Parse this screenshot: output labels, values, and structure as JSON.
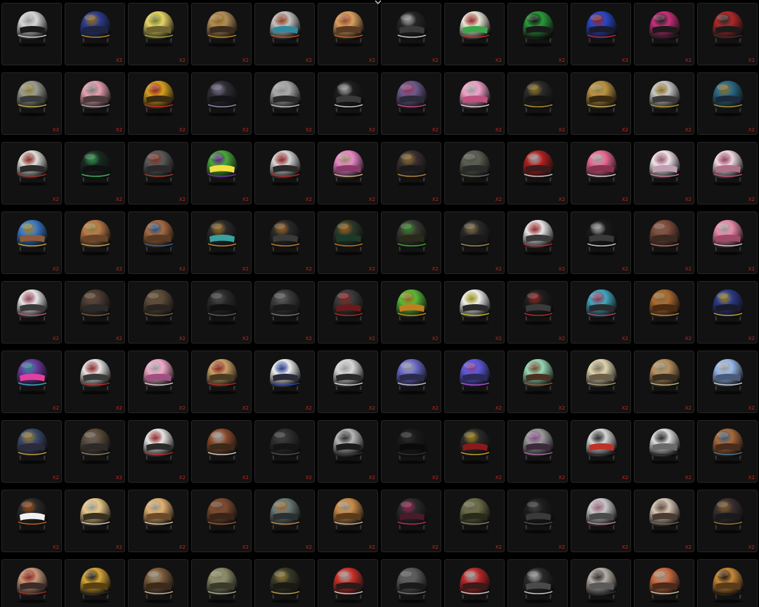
{
  "quantity_color": "#c2281d",
  "items": [
    {
      "icon": "white-viking-helmet-icon",
      "qty": "",
      "main": "#d6d6d6",
      "accent": "#f2f2f2",
      "visor": "#1a1a1a"
    },
    {
      "icon": "blue-stronghold-helmet-icon",
      "qty": "X2",
      "main": "#2b3c8f",
      "accent": "#e0a020",
      "visor": "#1d2440"
    },
    {
      "icon": "yellow-lemon-helmet-icon",
      "qty": "X2",
      "main": "#e7d466",
      "accent": "#b8c24a",
      "visor": "#6d6432"
    },
    {
      "icon": "tan-camo-helmet-icon",
      "qty": "X2",
      "main": "#b08c5a",
      "accent": "#e0a030",
      "visor": "#3a2c1c"
    },
    {
      "icon": "racing-orange-visor-helmet-icon",
      "qty": "X2",
      "main": "#c4c4c4",
      "accent": "#d85a28",
      "visor": "#2f8aa0"
    },
    {
      "icon": "chick-helmet-icon",
      "qty": "X2",
      "main": "#d8a060",
      "accent": "#e0703a",
      "visor": "#5a3a22"
    },
    {
      "icon": "black-white-striped-helmet-icon",
      "qty": "X2",
      "main": "#262626",
      "accent": "#f0f0f0",
      "visor": "#3a3a3a"
    },
    {
      "icon": "rooster-helmet-icon",
      "qty": "X2",
      "main": "#e8e8d8",
      "accent": "#e03028",
      "visor": "#3aa84a"
    },
    {
      "icon": "green-motocross-helmet-icon",
      "qty": "X2",
      "main": "#2a9a3a",
      "accent": "#121212",
      "visor": "#1a1a1a"
    },
    {
      "icon": "blue-motocross-helmet-icon",
      "qty": "X3",
      "main": "#2848c8",
      "accent": "#e03030",
      "visor": "#1a1a2a"
    },
    {
      "icon": "pink-motocross-helmet-icon",
      "qty": "X2",
      "main": "#c8307a",
      "accent": "#2a2a2a",
      "visor": "#1a1a1a"
    },
    {
      "icon": "red-motocross-helmet-icon",
      "qty": "X2",
      "main": "#b02828",
      "accent": "#3a3a3a",
      "visor": "#1a1a1a"
    },
    {
      "icon": "gray-star-helmet-icon",
      "qty": "X3",
      "main": "#9a9a92",
      "accent": "#d8c858",
      "visor": "#3a3a3a"
    },
    {
      "icon": "pink-bear-helmet-icon",
      "qty": "X2",
      "main": "#e8a0b0",
      "accent": "#c0c0c0",
      "visor": "#4a3a3a"
    },
    {
      "icon": "gold-chicken-helmet-icon",
      "qty": "X2",
      "main": "#d4a020",
      "accent": "#e03030",
      "visor": "#3a2a10"
    },
    {
      "icon": "black-level3-helmet-icon",
      "qty": "X2",
      "main": "#2e2e34",
      "accent": "#b0a0c8",
      "visor": "#141418"
    },
    {
      "icon": "silver-level3-helmet-icon",
      "qty": "X2",
      "main": "#a8a8a8",
      "accent": "#e0e0e0",
      "visor": "#2a2a2a"
    },
    {
      "icon": "black-racing-helmet-icon",
      "qty": "X2",
      "main": "#1e1e1e",
      "accent": "#f0f0f0",
      "visor": "#3a3a3a"
    },
    {
      "icon": "purple-devil-helmet-icon",
      "qty": "X2",
      "main": "#6a5a8a",
      "accent": "#e05090",
      "visor": "#2a2a3a"
    },
    {
      "icon": "pink-bunny-helmet-icon",
      "qty": "X2",
      "main": "#f0a0c8",
      "accent": "#f8f8f8",
      "visor": "#c05080"
    },
    {
      "icon": "anubis-helmet-icon",
      "qty": "X2",
      "main": "#2a2a2a",
      "accent": "#d4a830",
      "visor": "#141414"
    },
    {
      "icon": "golden-wing-helmet-icon",
      "qty": "X2",
      "main": "#b89040",
      "accent": "#e8c870",
      "visor": "#3a2a10"
    },
    {
      "icon": "silver-gold-wing-helmet-icon",
      "qty": "X2",
      "main": "#c8c8c8",
      "accent": "#d4a830",
      "visor": "#3a3a3a"
    },
    {
      "icon": "blue-dragon-helmet-icon",
      "qty": "X2",
      "main": "#2a6888",
      "accent": "#d4a830",
      "visor": "#1a2a3a"
    },
    {
      "icon": "white-paper-helmet-icon",
      "qty": "X2",
      "main": "#e0e0dc",
      "accent": "#c03028",
      "visor": "#2a2a2a"
    },
    {
      "icon": "neon-green-racing-helmet-icon",
      "qty": "X2",
      "main": "#1a2a22",
      "accent": "#48d870",
      "visor": "#101010"
    },
    {
      "icon": "gray-horned-helmet-icon",
      "qty": "X2",
      "main": "#5a5a5a",
      "accent": "#c04830",
      "visor": "#2a2a2a"
    },
    {
      "icon": "green-monster-helmet-icon",
      "qty": "X2",
      "main": "#48a838",
      "accent": "#8a30c8",
      "visor": "#f0e040"
    },
    {
      "icon": "white-red-horned-helmet-icon",
      "qty": "X2",
      "main": "#d8d8d8",
      "accent": "#d02828",
      "visor": "#2a2a2a"
    },
    {
      "icon": "pink-icecream-helmet-icon",
      "qty": "X2",
      "main": "#e888c8",
      "accent": "#f0d8a0",
      "visor": "#8a3a6a"
    },
    {
      "icon": "black-goggle-helmet-icon",
      "qty": "X2",
      "main": "#3a3030",
      "accent": "#d0a040",
      "visor": "#1a1a1a"
    },
    {
      "icon": "olive-military-helmet-icon",
      "qty": "X2",
      "main": "#5a5e52",
      "accent": "#7a7e70",
      "visor": "#2a2a2a"
    },
    {
      "icon": "santa-helmet-icon",
      "qty": "X2",
      "main": "#b02020",
      "accent": "#f0f0f0",
      "visor": "#3a1a1a"
    },
    {
      "icon": "pink-rabbit-helmet-icon",
      "qty": "X2",
      "main": "#e86890",
      "accent": "#f8f8f8",
      "visor": "#8a3050"
    },
    {
      "icon": "white-bunny-ear-helmet-icon",
      "qty": "X2",
      "main": "#f2e6ec",
      "accent": "#e888a8",
      "visor": "#c0a0b0"
    },
    {
      "icon": "white-pink-bunny-helmet-icon",
      "qty": "X2",
      "main": "#f0dce4",
      "accent": "#e05a88",
      "visor": "#b07088"
    },
    {
      "icon": "brown-bear-blue-helmet-icon",
      "qty": "X2",
      "main": "#3a78c8",
      "accent": "#f0c830",
      "visor": "#8a5a3a"
    },
    {
      "icon": "brown-bear-ear-helmet-icon",
      "qty": "X2",
      "main": "#b87848",
      "accent": "#e0c060",
      "visor": "#6a4428"
    },
    {
      "icon": "brown-bear-mask-helmet-icon",
      "qty": "X2",
      "main": "#a86a40",
      "accent": "#3a78c8",
      "visor": "#5a3a22"
    },
    {
      "icon": "orange-level3-helmet-icon",
      "qty": "X2",
      "main": "#2a2a2a",
      "accent": "#e8a030",
      "visor": "#3aa0a0"
    },
    {
      "icon": "black-orange-visor-helmet-icon",
      "qty": "X2",
      "main": "#2a2a2a",
      "accent": "#e89030",
      "visor": "#3a3a3a"
    },
    {
      "icon": "green-orange-racing-helmet-icon",
      "qty": "X2",
      "main": "#2a3a2a",
      "accent": "#e88a20",
      "visor": "#1a3a2a"
    },
    {
      "icon": "spiked-dark-helmet-icon",
      "qty": "X2",
      "main": "#3a3a32",
      "accent": "#48c838",
      "visor": "#2a2a1a"
    },
    {
      "icon": "dark-mohawk-helmet-icon",
      "qty": "X2",
      "main": "#2a2a2a",
      "accent": "#c0a060",
      "visor": "#1a1a1a"
    },
    {
      "icon": "graffiti-white-helmet-icon",
      "qty": "X2",
      "main": "#e8e8e8",
      "accent": "#d83030",
      "visor": "#3a3a3a"
    },
    {
      "icon": "zebra-tiger-helmet-icon",
      "qty": "X2",
      "main": "#1a1a1a",
      "accent": "#f0f0f0",
      "visor": "#3a3a3a"
    },
    {
      "icon": "steampunk-mouse-helmet-icon",
      "qty": "X2",
      "main": "#7a4a3a",
      "accent": "#c08870",
      "visor": "#3a2a22"
    },
    {
      "icon": "pink-elephant-helmet-icon",
      "qty": "X2",
      "main": "#e88aa8",
      "accent": "#f8f0f0",
      "visor": "#a04a6a"
    },
    {
      "icon": "white-pink-tag-helmet-icon",
      "qty": "X2",
      "main": "#e8e8e8",
      "accent": "#e06080",
      "visor": "#3a3a3a"
    },
    {
      "icon": "spiky-brown-helmet-icon",
      "qty": "X2",
      "main": "#4a3a32",
      "accent": "#8a6a50",
      "visor": "#2a2a2a"
    },
    {
      "icon": "plaid-brown-helmet-icon",
      "qty": "X2",
      "main": "#5a4a38",
      "accent": "#8a7050",
      "visor": "#2a2420"
    },
    {
      "icon": "black-glossy-helmet-icon",
      "qty": "X2",
      "main": "#2a2a2a",
      "accent": "#6a6a6a",
      "visor": "#101010"
    },
    {
      "icon": "dark-level2-helmet-icon",
      "qty": "X2",
      "main": "#3a3a3a",
      "accent": "#8a8a8a",
      "visor": "#1a1a1a"
    },
    {
      "icon": "red-visor-knight-helmet-icon",
      "qty": "X2",
      "main": "#3a3a3a",
      "accent": "#d03030",
      "visor": "#6a1a1a"
    },
    {
      "icon": "green-yellow-racing-helmet-icon",
      "qty": "X2",
      "main": "#58b838",
      "accent": "#e8a020",
      "visor": "#c08020"
    },
    {
      "icon": "white-yellow-motocross-helmet-icon",
      "qty": "X2",
      "main": "#f0f0f0",
      "accent": "#e8e020",
      "visor": "#2a2a2a"
    },
    {
      "icon": "black-red-motocross-helmet-icon",
      "qty": "X2",
      "main": "#1e1e1e",
      "accent": "#d83030",
      "visor": "#3a3a3a"
    },
    {
      "icon": "teal-pink-racing-helmet-icon",
      "qty": "X2",
      "main": "#40a8c0",
      "accent": "#e04878",
      "visor": "#2a2a2a"
    },
    {
      "icon": "bamboo-woven-helmet-icon",
      "qty": "X2",
      "main": "#a86a30",
      "accent": "#d0a050",
      "visor": "#4a2a10"
    },
    {
      "icon": "blue-gold-crest-helmet-icon",
      "qty": "X2",
      "main": "#2a3a88",
      "accent": "#e8c030",
      "visor": "#1a1a2a"
    },
    {
      "icon": "purple-racing-helmet-icon",
      "qty": "X2",
      "main": "#6a3a9a",
      "accent": "#40d0e0",
      "visor": "#e040a0"
    },
    {
      "icon": "white-red-cow-helmet-icon",
      "qty": "X2",
      "main": "#e8e8e8",
      "accent": "#d03030",
      "visor": "#3a3a3a"
    },
    {
      "icon": "pink-bear-ear-helmet-icon",
      "qty": "X2",
      "main": "#f0a8c8",
      "accent": "#f8f8f8",
      "visor": "#a05080"
    },
    {
      "icon": "tan-red-stripe-helmet-icon",
      "qty": "X2",
      "main": "#c8a068",
      "accent": "#c83028",
      "visor": "#4a3a22"
    },
    {
      "icon": "white-blue-racing-helmet-icon",
      "qty": "X2",
      "main": "#f0f0f0",
      "accent": "#2848c8",
      "visor": "#2a2a3a"
    },
    {
      "icon": "silver-wing-level3-helmet-icon",
      "qty": "X2",
      "main": "#d8d8d8",
      "accent": "#f8f8f8",
      "visor": "#2a2a2a"
    },
    {
      "icon": "galaxy-racing-helmet-icon",
      "qty": "X2",
      "main": "#6a6ac8",
      "accent": "#e8e8f8",
      "visor": "#2a2a4a"
    },
    {
      "icon": "galaxy-level3-helmet-icon",
      "qty": "X2",
      "main": "#5a5ad8",
      "accent": "#d060e0",
      "visor": "#2a2a5a"
    },
    {
      "icon": "mint-brown-helmet-icon",
      "qty": "X2",
      "main": "#98d8b8",
      "accent": "#a86a40",
      "visor": "#4a3020"
    },
    {
      "icon": "beige-military-helmet-icon",
      "qty": "X2",
      "main": "#e0d4b0",
      "accent": "#c0b490",
      "visor": "#6a6048"
    },
    {
      "icon": "khaki-face-mask-helmet-icon",
      "qty": "X2",
      "main": "#b89060",
      "accent": "#e0d0a0",
      "visor": "#3a3020"
    },
    {
      "icon": "blue-white-cloud-helmet-icon",
      "qty": "X2",
      "main": "#98b8e8",
      "accent": "#f8f8f8",
      "visor": "#4a5a7a"
    },
    {
      "icon": "navy-moon-helmet-icon",
      "qty": "X2",
      "main": "#3a4a6a",
      "accent": "#e8b840",
      "visor": "#2a2a3a"
    },
    {
      "icon": "aviator-goggle-helmet-icon",
      "qty": "X2",
      "main": "#5a4a3a",
      "accent": "#a09080",
      "visor": "#2a2a2a"
    },
    {
      "icon": "jester-helmet-icon",
      "qty": "X2",
      "main": "#e8e8e8",
      "accent": "#d83030",
      "visor": "#2a2a2a"
    },
    {
      "icon": "brown-checker-helmet-icon",
      "qty": "X2",
      "main": "#8a4a2a",
      "accent": "#f0f0f0",
      "visor": "#3a2a1a"
    },
    {
      "icon": "plain-black-helmet-icon",
      "qty": "X2",
      "main": "#2e2e2e",
      "accent": "#5a5a5a",
      "visor": "#141414"
    },
    {
      "icon": "silver-fullface-helmet-icon",
      "qty": "X2",
      "main": "#b8b8b8",
      "accent": "#3a3a3a",
      "visor": "#1a1a1a"
    },
    {
      "icon": "black-fullface-helmet-icon",
      "qty": "X2",
      "main": "#1a1a1a",
      "accent": "#3a3a3a",
      "visor": "#0a0a0a"
    },
    {
      "icon": "black-yellow-dot-helmet-icon",
      "qty": "X2",
      "main": "#2a2a2a",
      "accent": "#e8c020",
      "visor": "#8a1a1a"
    },
    {
      "icon": "silver-pink-visor-helmet-icon",
      "qty": "X2",
      "main": "#9a9a9a",
      "accent": "#c878c8",
      "visor": "#3a2a3a"
    },
    {
      "icon": "black-white-bull-helmet-icon",
      "qty": "X2",
      "main": "#d8d8d8",
      "accent": "#2a2a2a",
      "visor": "#c03028"
    },
    {
      "icon": "cow-print-helmet-icon",
      "qty": "X2",
      "main": "#e0e0e0",
      "accent": "#2a2a2a",
      "visor": "#6a6a6a"
    },
    {
      "icon": "brown-leather-helmet-icon",
      "qty": "X2",
      "main": "#a86a3a",
      "accent": "#5a8ab8",
      "visor": "#4a2a1a"
    },
    {
      "icon": "orange-black-motocross-helmet-icon",
      "qty": "X2",
      "main": "#2a2a2a",
      "accent": "#e87020",
      "visor": "#f0f0f0"
    },
    {
      "icon": "yellow-cat-level3-helmet-icon",
      "qty": "X2",
      "main": "#e8c888",
      "accent": "#f8f0d8",
      "visor": "#3a3020"
    },
    {
      "icon": "shiba-dog-helmet-icon",
      "qty": "X2",
      "main": "#e0b070",
      "accent": "#f8e8c8",
      "visor": "#6a4a2a"
    },
    {
      "icon": "brown-leather-aviator-helmet-icon",
      "qty": "X2",
      "main": "#7a4a30",
      "accent": "#a86a48",
      "visor": "#3a2418"
    },
    {
      "icon": "tiger-cat-helmet-icon",
      "qty": "X2",
      "main": "#6a7a78",
      "accent": "#e8a050",
      "visor": "#2a3030"
    },
    {
      "icon": "brown-patch-helmet-icon",
      "qty": "X2",
      "main": "#c88a48",
      "accent": "#e8d8b8",
      "visor": "#5a3a1a"
    },
    {
      "icon": "black-pink-racing-helmet-icon",
      "qty": "X2",
      "main": "#2a2a2a",
      "accent": "#e03078",
      "visor": "#4a1a2a"
    },
    {
      "icon": "camo-green-helmet-icon",
      "qty": "X2",
      "main": "#6a6a48",
      "accent": "#9a9a70",
      "visor": "#2a2a1a"
    },
    {
      "icon": "black-fighter-helmet-icon",
      "qty": "X2",
      "main": "#1e1e1e",
      "accent": "#5a5a5a",
      "visor": "#3a3a3a"
    },
    {
      "icon": "gray-mouse-helmet-icon",
      "qty": "X2",
      "main": "#c8c8c8",
      "accent": "#e898b8",
      "visor": "#4a4a4a"
    },
    {
      "icon": "beige-camo-helmet-icon",
      "qty": "X2",
      "main": "#d8c8b8",
      "accent": "#8a6a58",
      "visor": "#4a3a32"
    },
    {
      "icon": "spiked-punk-helmet-icon",
      "qty": "X2",
      "main": "#3a3030",
      "accent": "#c08a40",
      "visor": "#1a1a1a"
    },
    {
      "icon": "tan-red-dragon-helmet-icon",
      "qty": "",
      "main": "#c89878",
      "accent": "#c83028",
      "visor": "#3a2a2a"
    },
    {
      "icon": "yellow-monster-helmet-icon",
      "qty": "",
      "main": "#d8a838",
      "accent": "#2a2a2a",
      "visor": "#5a4010"
    },
    {
      "icon": "brown-horned-helmet-icon",
      "qty": "",
      "main": "#7a5a3a",
      "accent": "#e8d8b8",
      "visor": "#3a2a1a"
    },
    {
      "icon": "olive-camo-helmet-icon",
      "qty": "",
      "main": "#8a8a68",
      "accent": "#c8c8a0",
      "visor": "#3a3a2a"
    },
    {
      "icon": "gold-pattern-helmet-icon",
      "qty": "",
      "main": "#3a3a2a",
      "accent": "#d8b850",
      "visor": "#1a1a10"
    },
    {
      "icon": "red-cat-ear-helmet-icon",
      "qty": "",
      "main": "#c83028",
      "accent": "#f0f0f0",
      "visor": "#2a1a1a"
    },
    {
      "icon": "dark-knight-helmet-icon",
      "qty": "",
      "main": "#5a5a5a",
      "accent": "#8a8a8a",
      "visor": "#1a1a1a"
    },
    {
      "icon": "red-flag-helmet-icon",
      "qty": "",
      "main": "#b82828",
      "accent": "#f0f0f0",
      "visor": "#3a1a1a"
    },
    {
      "icon": "black-white-spotted-helmet-icon",
      "qty": "",
      "main": "#2a2a2a",
      "accent": "#f0f0f0",
      "visor": "#4a4a4a"
    },
    {
      "icon": "gray-cross-helmet-icon",
      "qty": "",
      "main": "#b8b0a8",
      "accent": "#3a3a3a",
      "visor": "#5a5a5a"
    },
    {
      "icon": "orange-leopard-helmet-icon",
      "qty": "",
      "main": "#c86a40",
      "accent": "#f0e0c8",
      "visor": "#4a2a1a"
    },
    {
      "icon": "leopard-print-helmet-icon",
      "qty": "",
      "main": "#c88a38",
      "accent": "#2a1a10",
      "visor": "#5a3a18"
    }
  ]
}
